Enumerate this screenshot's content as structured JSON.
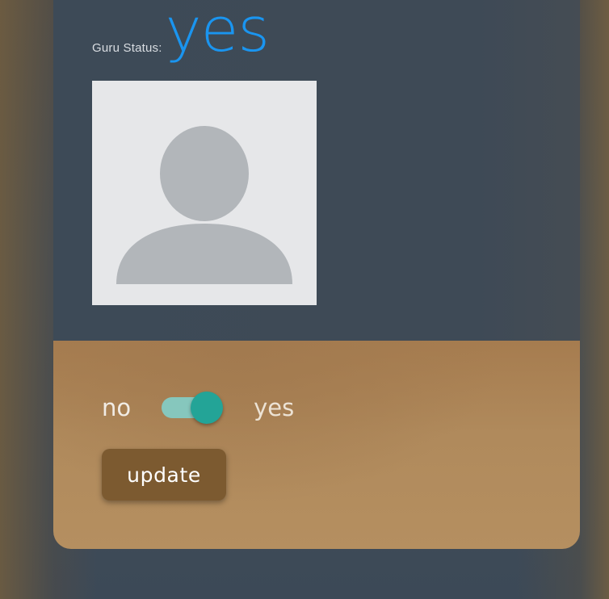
{
  "guru_status": {
    "label": "Guru Status:",
    "value": "yes"
  },
  "profile": {
    "avatar_icon": "default-user-avatar-icon"
  },
  "toggle": {
    "off_label": "no",
    "on_label": "yes",
    "checked": true
  },
  "actions": {
    "update_label": "update"
  },
  "colors": {
    "status_value": "#1a95f0",
    "card_top": "#3d4a56",
    "card_bottom": "#b08a5c",
    "switch_track": "#86c7bd",
    "switch_thumb": "#23a497",
    "update_button": "#7c5a30"
  }
}
